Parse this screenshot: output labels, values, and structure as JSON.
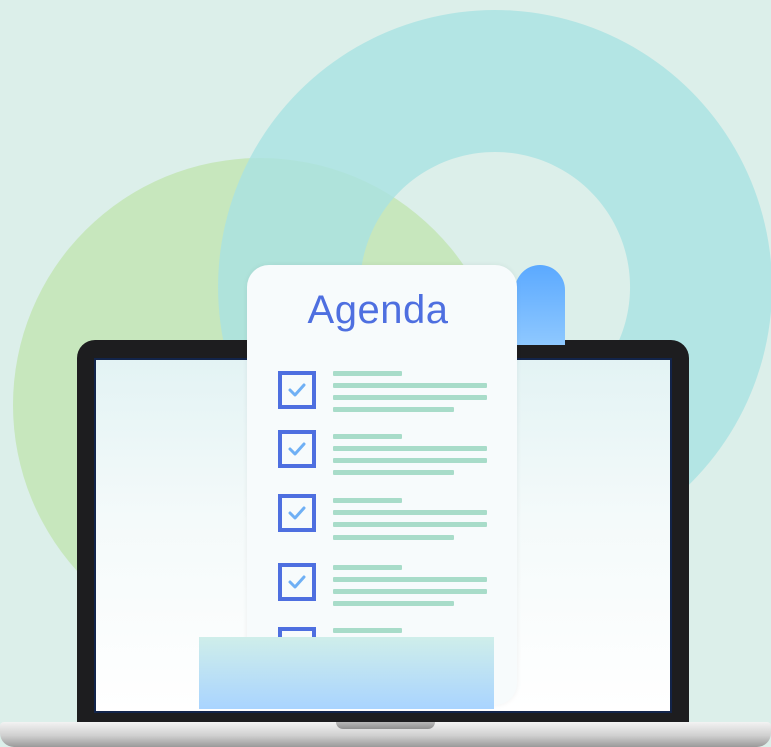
{
  "document": {
    "title": "Agenda",
    "items": [
      {
        "checked": true
      },
      {
        "checked": true
      },
      {
        "checked": true
      },
      {
        "checked": true
      },
      {
        "checked": true
      }
    ]
  },
  "icons": {
    "checkbox": "checkbox-checked-icon",
    "document": "document-scroll-icon",
    "laptop": "laptop-icon"
  },
  "colors": {
    "background": "#dcefea",
    "accent_blue": "#4e6fe0",
    "text_lines": "#a8dcc9",
    "circle_teal": "#b3e4e4",
    "circle_green": "#c8e6bd",
    "laptop_frame": "#1d1d1f"
  }
}
